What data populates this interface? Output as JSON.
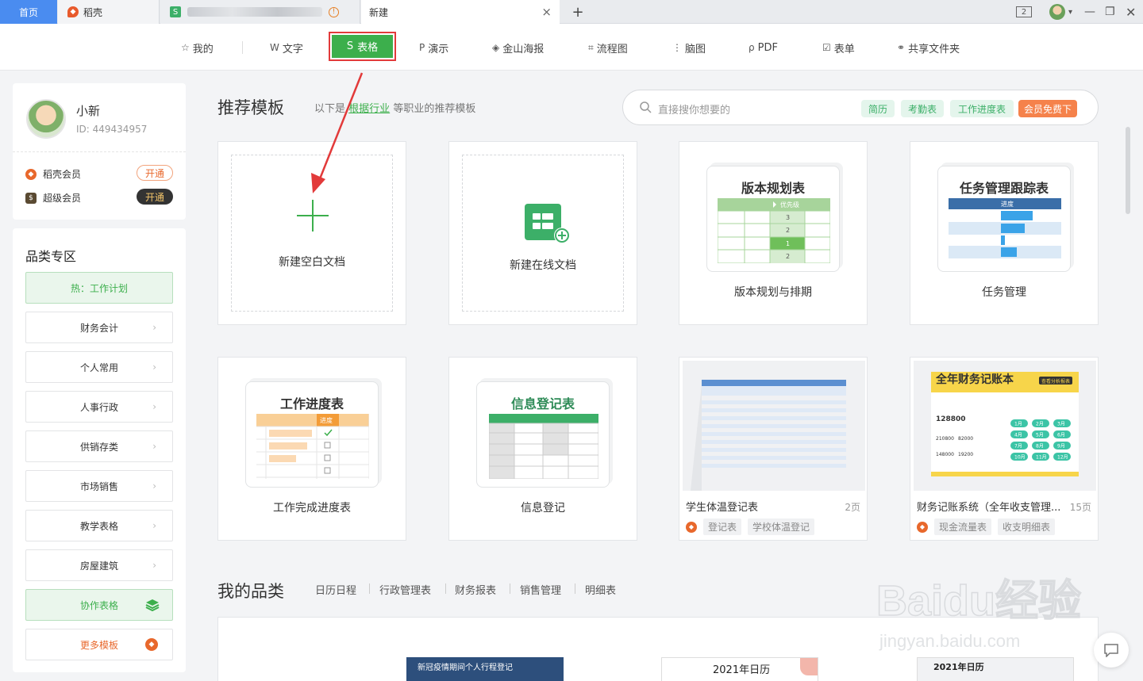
{
  "tabs": {
    "home": "首页",
    "daoke": "稻壳",
    "new": "新建",
    "new_close": "×",
    "add": "+"
  },
  "window": {
    "counter": "2"
  },
  "nav": {
    "mine": "我的",
    "text": "文字",
    "sheet": "表格",
    "present": "演示",
    "poster": "金山海报",
    "flow": "流程图",
    "mind": "脑图",
    "pdf": "PDF",
    "form": "表单",
    "share": "共享文件夹"
  },
  "user": {
    "name": "小新",
    "id": "ID: 449434957",
    "vip1_label": "稻壳会员",
    "vip1_btn": "开通",
    "vip2_label": "超级会员",
    "vip2_btn": "开通"
  },
  "categories": {
    "title": "品类专区",
    "hot": "热：工作计划",
    "items": [
      "财务会计",
      "个人常用",
      "人事行政",
      "供销存类",
      "市场销售",
      "教学表格",
      "房屋建筑"
    ],
    "collab": "协作表格",
    "more": "更多模板"
  },
  "recommend": {
    "title": "推荐模板",
    "sub_prefix": "以下是",
    "sub_link": "根据行业",
    "sub_suffix": "等职业的推荐模板",
    "search_placeholder": "直接搜你想要的",
    "chips": [
      "简历",
      "考勤表",
      "工作进度表"
    ],
    "vip_chip": "会员免费下"
  },
  "templates": {
    "blank": "新建空白文档",
    "online": "新建在线文档",
    "version_title": "版本规划表",
    "version_label": "版本规划与排期",
    "version_col": "优先级",
    "version_vals": [
      "3",
      "2",
      "1",
      "2"
    ],
    "task_title": "任务管理跟踪表",
    "task_label": "任务管理",
    "task_col": "进度",
    "progress_title": "工作进度表",
    "progress_label": "工作完成进度表",
    "progress_col": "进度",
    "info_title": "信息登记表",
    "info_label": "信息登记",
    "temp_name": "学生体温登记表",
    "temp_pages": "2页",
    "temp_tags": [
      "登记表",
      "学校体温登记"
    ],
    "fin_name": "财务记账系统（全年收支管理...",
    "fin_pages": "15页",
    "fin_tags": [
      "现金流量表",
      "收支明细表"
    ],
    "fin_thumb_title": "全年财务记账本",
    "fin_thumb_num": "128800",
    "fin_thumb_badge": "查看分析报表",
    "fin_thumb_nums": [
      "210800",
      "82000",
      "148000",
      "19200"
    ],
    "fin_months": [
      "1月",
      "2月",
      "3月",
      "4月",
      "5月",
      "6月",
      "7月",
      "8月",
      "9月",
      "10月",
      "11月",
      "12月"
    ]
  },
  "mycat": {
    "title": "我的品类",
    "links": [
      "日历日程",
      "行政管理表",
      "财务报表",
      "销售管理",
      "明细表"
    ]
  },
  "bottom": {
    "b1": "新冠疫情期间个人行程登记",
    "b2": "2021年日历",
    "b3": "2021年日历"
  },
  "watermark": {
    "brand": "Baidu经验",
    "url": "jingyan.baidu.com"
  },
  "colors": {
    "green": "#3caf4c",
    "highlight_border": "#e23a3a",
    "arrow": "#e23a3a"
  }
}
